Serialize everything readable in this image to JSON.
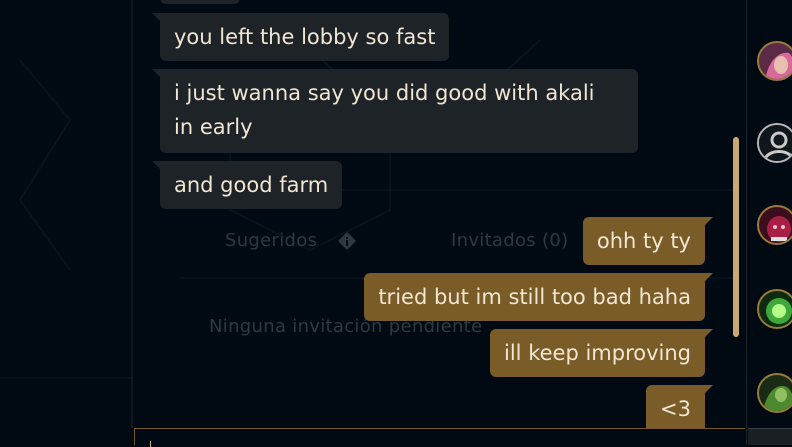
{
  "lobby": {
    "suggested_label": "Sugeridos",
    "invited_label": "Invitados (0)",
    "no_invites_text": "Ninguna invitación pendiente"
  },
  "chat": {
    "messages": [
      {
        "direction": "incoming",
        "text": "you left the lobby so fast"
      },
      {
        "direction": "incoming",
        "lines": [
          "i just wanna say you did good with akali",
          "in early"
        ]
      },
      {
        "direction": "incoming",
        "text": "and good farm"
      },
      {
        "direction": "outgoing",
        "text": "ohh ty ty"
      },
      {
        "direction": "outgoing",
        "text": "tried but im still too bad haha"
      },
      {
        "direction": "outgoing",
        "text": "ill keep improving"
      },
      {
        "direction": "outgoing",
        "text": "<3"
      }
    ]
  },
  "friends": [
    {
      "icon": "champion-portrait-pink-hair-icon",
      "color": "#8e4a6a"
    },
    {
      "icon": "default-user-silhouette-icon",
      "color": "#c9c9c9"
    },
    {
      "icon": "champion-portrait-red-icon",
      "color": "#8a1f3c"
    },
    {
      "icon": "champion-portrait-green-icon",
      "color": "#2f7a2a"
    },
    {
      "icon": "champion-portrait-green-dark-icon",
      "color": "#3b6a2a"
    }
  ],
  "colors": {
    "background": "#010a13",
    "incoming_bubble": "#1e2328",
    "outgoing_bubble": "#7a5c29",
    "accent_gold": "#c8aa6e",
    "text": "#f0e6d2"
  }
}
